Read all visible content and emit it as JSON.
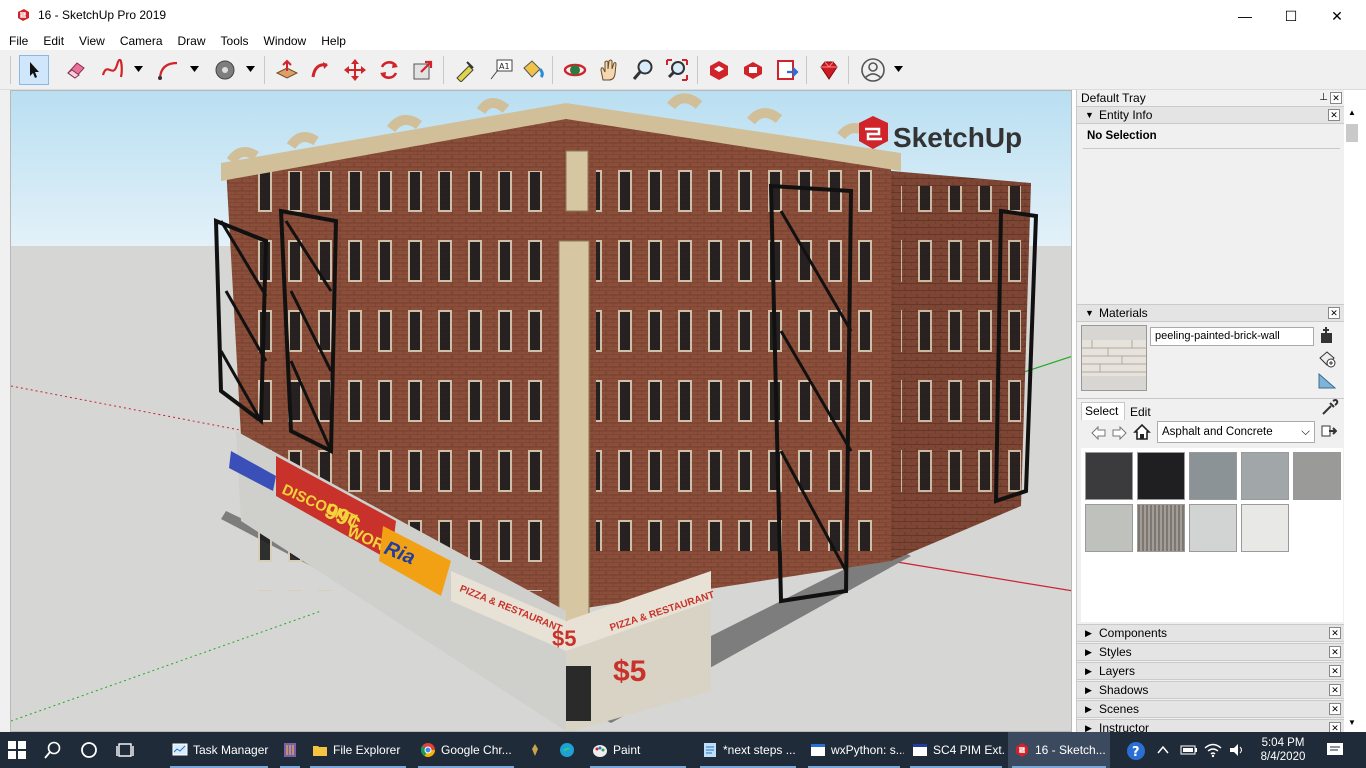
{
  "window": {
    "title": "16 - SketchUp Pro 2019",
    "controls": [
      "—",
      "☐",
      "✕"
    ]
  },
  "menu": [
    "File",
    "Edit",
    "View",
    "Camera",
    "Draw",
    "Tools",
    "Window",
    "Help"
  ],
  "toolbar": {
    "tools": [
      "select-tool",
      "eraser-tool",
      "freehand-tool",
      "arc-tool",
      "paint-bucket-tool",
      "push-pull-tool",
      "follow-me-tool",
      "move-tool",
      "rotate-tool",
      "scale-tool",
      "tape-measure-tool",
      "text-tool",
      "paint-tool",
      "orbit-tool",
      "pan-tool",
      "zoom-tool",
      "zoom-extents-tool",
      "3d-warehouse-tool",
      "extension-warehouse-tool",
      "send-to-layout-tool",
      "ruby-extension-tool",
      "account-tool"
    ],
    "text_label": "A1"
  },
  "viewport": {
    "logo_text": "SketchUp",
    "signs": {
      "discount": "DISCOUNT",
      "price99": "99¢",
      "world": "WORLD",
      "ria": "Ria",
      "pizza": "PIZZA & RESTAURANT",
      "price5": "$5"
    }
  },
  "tray": {
    "title": "Default Tray",
    "entity_info": {
      "label": "Entity Info",
      "selection": "No Selection"
    },
    "materials": {
      "label": "Materials",
      "current_name": "peeling-painted-brick-wall",
      "tabs": [
        "Select",
        "Edit"
      ],
      "collection": "Asphalt and Concrete",
      "swatch_colors": [
        "#3b3b3d",
        "#1f1f21",
        "#8c9396",
        "#a1a6a8",
        "#9a9a98",
        "#bfc2bc",
        "#8f8a85",
        "#d2d4d4",
        "#e8e8e6"
      ]
    },
    "collapsed_panels": [
      "Components",
      "Styles",
      "Layers",
      "Shadows",
      "Scenes",
      "Instructor"
    ]
  },
  "taskbar": {
    "items": [
      {
        "label": "Task Manager",
        "icon": "task-manager-icon"
      },
      {
        "label": "",
        "icon": "app-icon"
      },
      {
        "label": "File Explorer",
        "icon": "folder-icon"
      },
      {
        "label": "Google Chr...",
        "icon": "chrome-icon"
      },
      {
        "label": "",
        "icon": "python-icon"
      },
      {
        "label": "",
        "icon": "edge-icon"
      },
      {
        "label": "Paint",
        "icon": "paint-icon"
      },
      {
        "label": "*next steps ...",
        "icon": "notepad-icon"
      },
      {
        "label": "wxPython: s...",
        "icon": "wx-icon"
      },
      {
        "label": "SC4 PIM Ext...",
        "icon": "sc4-icon"
      },
      {
        "label": "16 - Sketch...",
        "icon": "sketchup-icon"
      }
    ],
    "time": "5:04 PM",
    "date": "8/4/2020"
  }
}
